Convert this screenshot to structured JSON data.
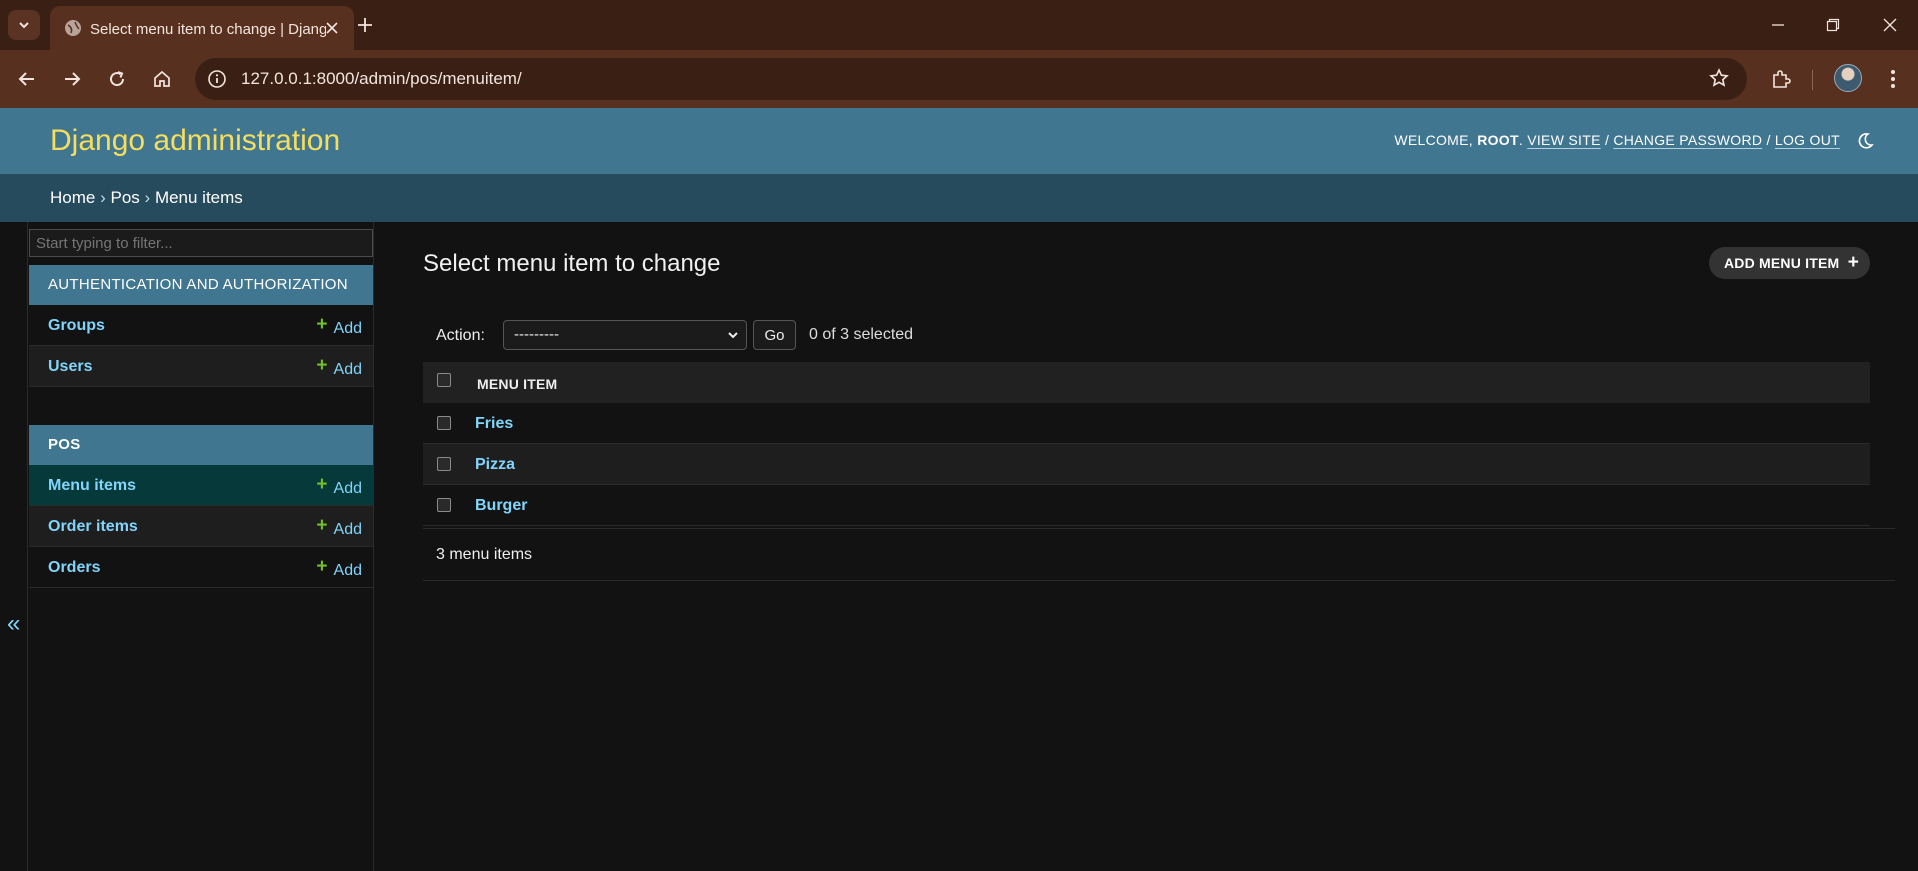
{
  "browser": {
    "tab_title": "Select menu item to change | Django site admin",
    "url": "127.0.0.1:8000/admin/pos/menuitem/"
  },
  "header": {
    "branding": "Django administration",
    "welcome": "WELCOME,",
    "username": "ROOT",
    "view_site": "VIEW SITE",
    "change_password": "CHANGE PASSWORD",
    "log_out": "LOG OUT",
    "sep": "/"
  },
  "breadcrumbs": {
    "home": "Home",
    "app": "Pos",
    "current": "Menu items",
    "separator": "›"
  },
  "sidebar": {
    "filter_placeholder": "Start typing to filter...",
    "collapse_label": "«",
    "modules": [
      {
        "caption": "AUTHENTICATION AND AUTHORIZATION",
        "models": [
          {
            "name": "Groups",
            "add": "Add"
          },
          {
            "name": "Users",
            "add": "Add"
          }
        ]
      },
      {
        "caption": "POS",
        "models": [
          {
            "name": "Menu items",
            "add": "Add",
            "current": true
          },
          {
            "name": "Order items",
            "add": "Add"
          },
          {
            "name": "Orders",
            "add": "Add"
          }
        ]
      }
    ]
  },
  "content": {
    "title": "Select menu item to change",
    "add_button": "ADD MENU ITEM",
    "action_label": "Action:",
    "action_selected": "---------",
    "go_label": "Go",
    "counter": "0 of 3 selected",
    "column_header": "MENU ITEM",
    "rows": [
      "Fries",
      "Pizza",
      "Burger"
    ],
    "paginator": "3 menu items"
  },
  "colors": {
    "header_bg": "#417690",
    "breadcrumb_bg": "#264b5d",
    "branding": "#f5dd5d",
    "link": "#81d4fa",
    "add_plus": "#70bf2b",
    "browser_frame": "#3a1f14"
  }
}
